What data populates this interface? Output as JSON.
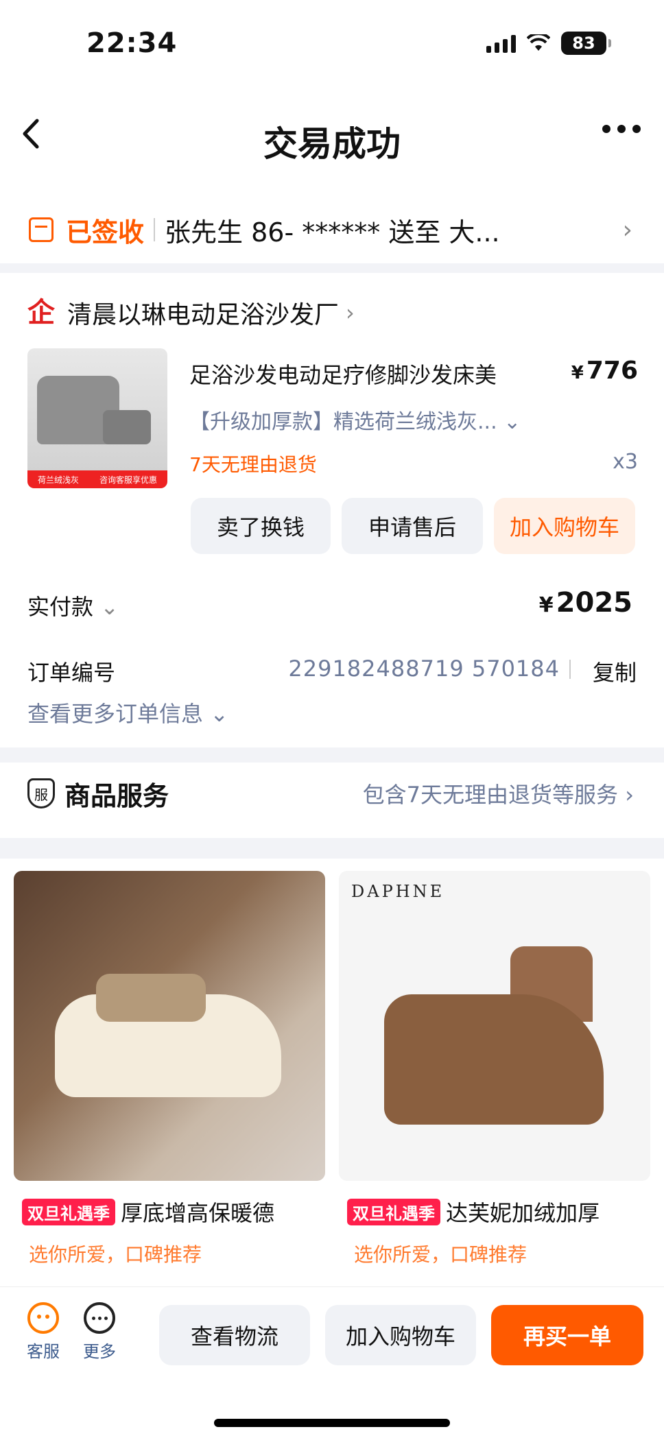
{
  "status_bar": {
    "time": "22:34",
    "battery": "83"
  },
  "header": {
    "title": "交易成功"
  },
  "delivery": {
    "status": "已签收",
    "address": "张先生 86- ****** 送至 大..."
  },
  "shop": {
    "name": "清晨以琳电动足浴沙发厂",
    "icon_glyph": "企"
  },
  "product": {
    "title": "足浴沙发电动足疗修脚沙发床美",
    "price_symbol": "¥",
    "price": "776",
    "spec": "【升级加厚款】精选荷兰绒浅灰...",
    "return_policy": "7天无理由退货",
    "quantity": "x3",
    "image_banner_left": "荷兰绒浅灰",
    "image_banner_right": "咨询客服享优惠"
  },
  "actions": {
    "sell": "卖了换钱",
    "after_sale": "申请售后",
    "add_cart": "加入购物车"
  },
  "payment": {
    "label": "实付款",
    "symbol": "¥",
    "amount": "2025"
  },
  "order": {
    "label": "订单编号",
    "number": "229182488719 570184",
    "copy": "复制",
    "more": "查看更多订单信息"
  },
  "service": {
    "icon_glyph": "服",
    "title": "商品服务",
    "desc": "包含7天无理由退货等服务"
  },
  "recommendations": [
    {
      "tag": "双旦礼遇季",
      "title": "厚底增高保暖德",
      "sub": "选你所爱，口碑推荐"
    },
    {
      "tag": "双旦礼遇季",
      "title": "达芙妮加绒加厚",
      "sub": "选你所爱，口碑推荐",
      "brand": "DAPHNE"
    }
  ],
  "bottom_bar": {
    "service_label": "客服",
    "more_label": "更多",
    "logistics": "查看物流",
    "add_cart": "加入购物车",
    "buy_again": "再买一单"
  },
  "colors": {
    "accent": "#ff5a00",
    "link_gray": "#6d7a99",
    "tag_red": "#ff1f4b"
  }
}
